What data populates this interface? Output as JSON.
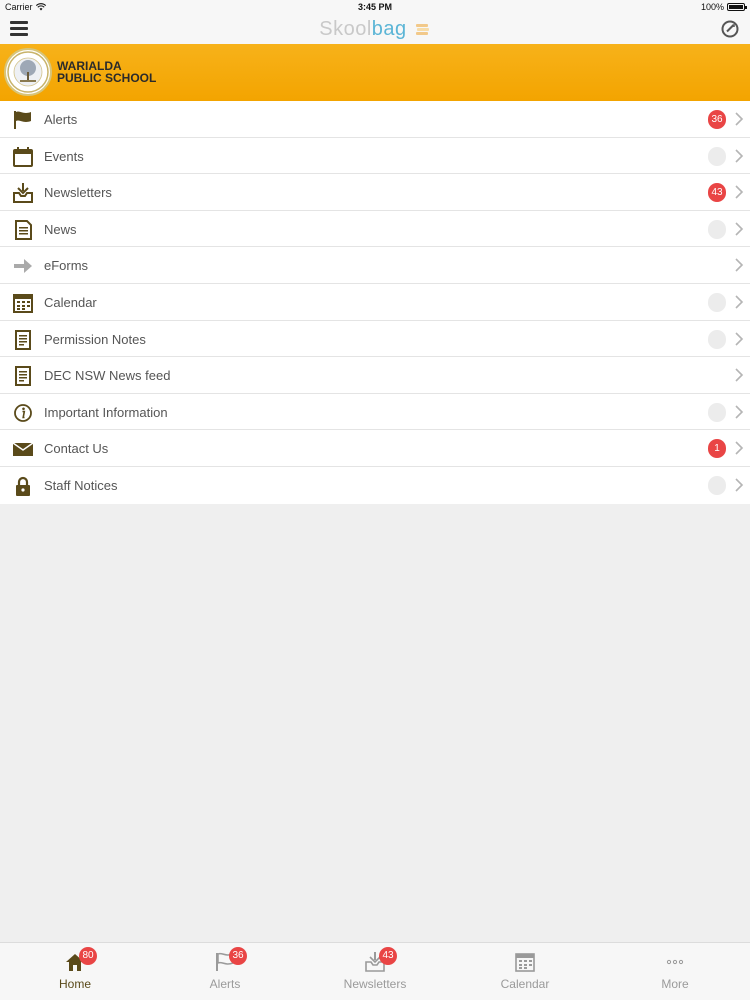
{
  "status_bar": {
    "carrier": "Carrier",
    "time": "3:45 PM",
    "battery": "100%"
  },
  "nav": {
    "brand_part1": "Skool",
    "brand_part2": "bag"
  },
  "school": {
    "line1": "WARIALDA",
    "line2": "PUBLIC SCHOOL"
  },
  "menu": [
    {
      "label": "Alerts",
      "icon": "flag-icon",
      "badge": "36"
    },
    {
      "label": "Events",
      "icon": "event-calendar-icon",
      "badge": ""
    },
    {
      "label": "Newsletters",
      "icon": "inbox-download-icon",
      "badge": "43"
    },
    {
      "label": "News",
      "icon": "document-icon",
      "badge": ""
    },
    {
      "label": "eForms",
      "icon": "arrow-right-icon",
      "badge": null
    },
    {
      "label": "Calendar",
      "icon": "calendar-grid-icon",
      "badge": ""
    },
    {
      "label": "Permission Notes",
      "icon": "note-icon",
      "badge": ""
    },
    {
      "label": "DEC NSW News feed",
      "icon": "note-icon",
      "badge": null
    },
    {
      "label": "Important Information",
      "icon": "info-icon",
      "badge": ""
    },
    {
      "label": "Contact Us",
      "icon": "envelope-icon",
      "badge": "1"
    },
    {
      "label": "Staff Notices",
      "icon": "lock-icon",
      "badge": ""
    }
  ],
  "tabs": [
    {
      "label": "Home",
      "icon": "home-icon",
      "badge": "80",
      "active": true
    },
    {
      "label": "Alerts",
      "icon": "flag-icon",
      "badge": "36"
    },
    {
      "label": "Newsletters",
      "icon": "inbox-download-icon",
      "badge": "43"
    },
    {
      "label": "Calendar",
      "icon": "calendar-grid-icon",
      "badge": null
    },
    {
      "label": "More",
      "icon": "more-dots-icon",
      "badge": null
    }
  ],
  "colors": {
    "banner": "#f3a400",
    "badge_red": "#e94545",
    "icon_brown": "#5a4a1a",
    "brand_blue": "#5bb5d6"
  }
}
